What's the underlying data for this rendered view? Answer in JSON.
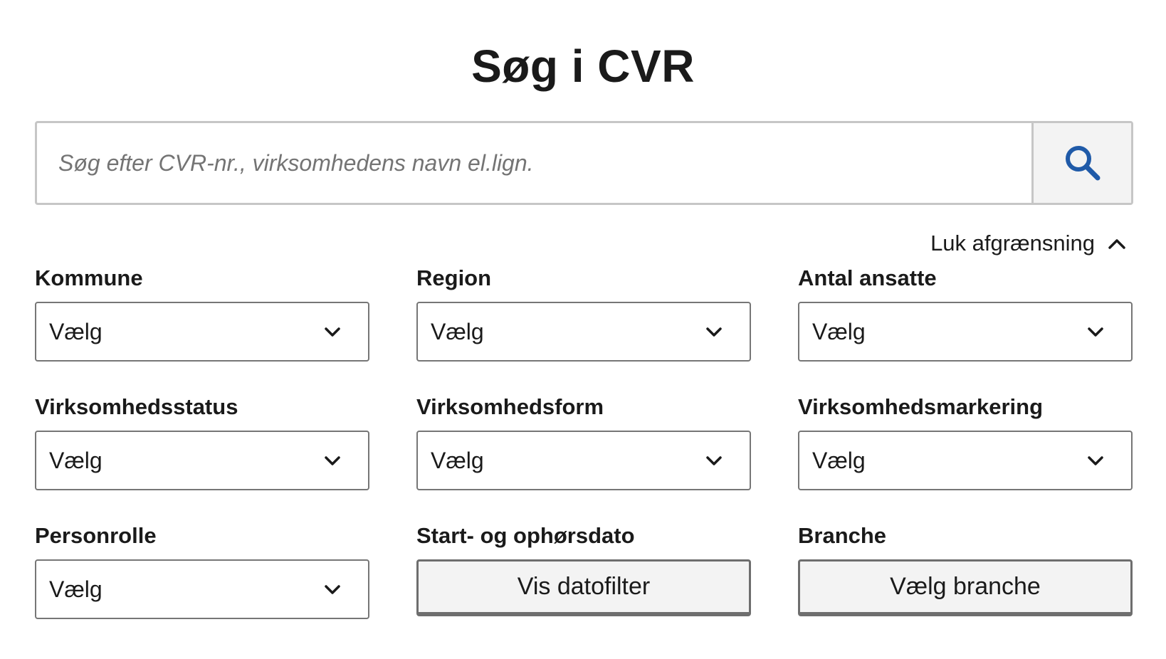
{
  "title": "Søg i CVR",
  "search": {
    "placeholder": "Søg efter CVR-nr., virksomhedens navn el.lign.",
    "button_icon": "search-icon"
  },
  "toggle": {
    "label": "Luk afgrænsning",
    "icon": "chevron-up-icon"
  },
  "filters": {
    "kommune": {
      "label": "Kommune",
      "value": "Vælg"
    },
    "region": {
      "label": "Region",
      "value": "Vælg"
    },
    "antal_ansatte": {
      "label": "Antal ansatte",
      "value": "Vælg"
    },
    "virksomhedsstatus": {
      "label": "Virksomhedsstatus",
      "value": "Vælg"
    },
    "virksomhedsform": {
      "label": "Virksomhedsform",
      "value": "Vælg"
    },
    "virksomhedsmarkering": {
      "label": "Virksomhedsmarkering",
      "value": "Vælg"
    },
    "personrolle": {
      "label": "Personrolle",
      "value": "Vælg"
    },
    "dato": {
      "label": "Start- og ophørsdato",
      "button": "Vis datofilter"
    },
    "branche": {
      "label": "Branche",
      "button": "Vælg branche"
    }
  },
  "colors": {
    "accent": "#1f5aa8",
    "border": "#c6c6c6",
    "button_bg": "#f3f3f3"
  }
}
